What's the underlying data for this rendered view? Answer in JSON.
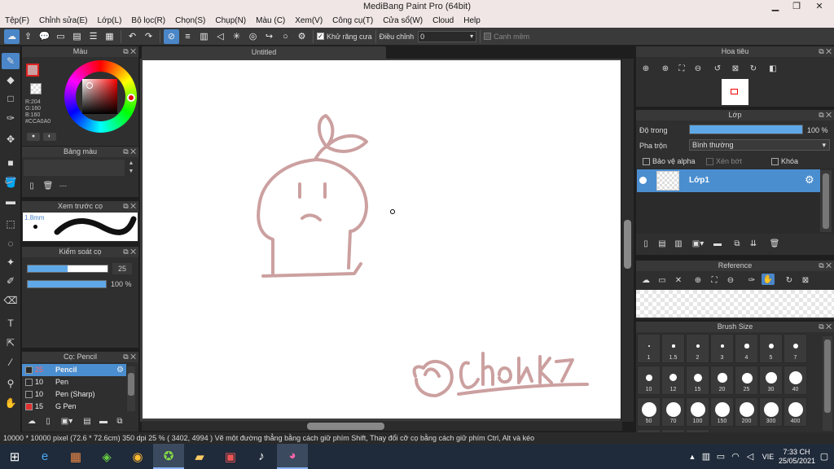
{
  "window": {
    "title": "MediBang Paint Pro (64bit)",
    "min": "▁",
    "max": "❐",
    "close": "✕"
  },
  "menu": [
    "Tệp(F)",
    "Chỉnh sửa(E)",
    "Lớp(L)",
    "Bộ lọc(R)",
    "Chọn(S)",
    "Chụp(N)",
    "Màu (C)",
    "Xem(V)",
    "Công cụ(T)",
    "Cửa sổ(W)",
    "Cloud",
    "Help"
  ],
  "toolbar": {
    "antialias_label": "Khử răng cưa",
    "adjust_label": "Điều chỉnh",
    "adjust_value": "0",
    "snap_label": "Canh mềm"
  },
  "color_panel": {
    "title": "Màu",
    "r": "R:204",
    "g": "G:160",
    "b": "B:160",
    "hex": "#CCA0A0",
    "main_color": "#cca0a0"
  },
  "palette_panel": {
    "title": "Bảng màu",
    "dash": "---"
  },
  "preview_panel": {
    "title": "Xem trước cọ",
    "size": "1.8mm"
  },
  "control_panel": {
    "title": "Kiểm soát cọ",
    "size_value": "25",
    "opacity_value": "100 %",
    "size_fraction": 0.5,
    "opacity_fraction": 1.0
  },
  "brush_panel": {
    "title": "Cọ: Pencil",
    "items": [
      {
        "size": "25",
        "name": "Pencil",
        "color": "#4a8ed0",
        "swatch": "#2a2a2a",
        "selected": true
      },
      {
        "size": "10",
        "name": "Pen",
        "swatch": "#2a2a2a",
        "selected": false
      },
      {
        "size": "10",
        "name": "Pen (Sharp)",
        "swatch": "#2a2a2a",
        "selected": false
      },
      {
        "size": "15",
        "name": "G Pen",
        "swatch": "#e03030",
        "selected": false
      }
    ]
  },
  "canvas": {
    "tab_title": "Untitled",
    "stroke_color": "#cca0a0"
  },
  "navigator": {
    "title": "Hoa tiêu"
  },
  "layer_panel": {
    "title": "Lớp",
    "opacity_label": "Độ trong",
    "opacity_value": "100 %",
    "opacity_fraction": 1.0,
    "blend_label": "Pha trộn",
    "blend_value": "Bình thường",
    "protect_alpha": "Bảo vệ alpha",
    "clip": "Xén bớt",
    "lock": "Khóa",
    "layer_name": "Lớp1"
  },
  "reference_panel": {
    "title": "Reference"
  },
  "brushsize_panel": {
    "title": "Brush Size",
    "sizes": [
      "1",
      "1.5",
      "2",
      "3",
      "4",
      "5",
      "7",
      "10",
      "12",
      "15",
      "20",
      "25",
      "30",
      "40",
      "50",
      "70",
      "100",
      "150",
      "200",
      "300",
      "400"
    ]
  },
  "status": {
    "text": "10000 * 10000 pixel  (72.6 * 72.6cm)  350 dpi  25 %  ( 3402, 4994 )  Vẽ một đường thẳng bằng cách giữ phím Shift, Thay đổi cỡ cọ bằng cách giữ phím Ctrl, Alt và kéo"
  },
  "taskbar": {
    "lang": "VIE",
    "time": "7:33 CH",
    "date": "25/05/2021"
  }
}
